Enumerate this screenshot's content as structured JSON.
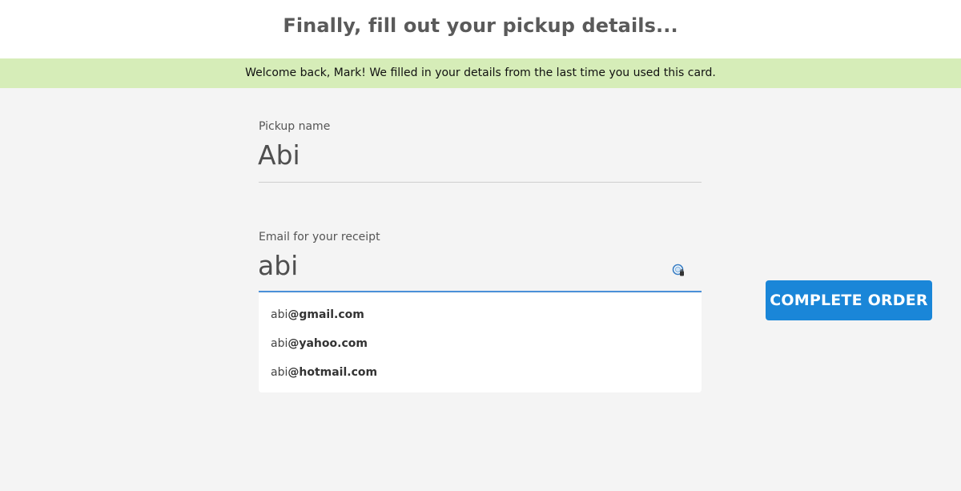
{
  "header": {
    "title": "Finally, fill out your pickup details..."
  },
  "banner": {
    "text": "Welcome back, Mark! We filled in your details from the last time you used this card."
  },
  "form": {
    "pickup_name": {
      "label": "Pickup name",
      "value": "Abi"
    },
    "email": {
      "label": "Email for your receipt",
      "value": "abi",
      "autofill_icon": "password-manager-key-icon"
    },
    "suggestions": [
      {
        "local": "abi",
        "domain": "@gmail.com"
      },
      {
        "local": "abi",
        "domain": "@yahoo.com"
      },
      {
        "local": "abi",
        "domain": "@hotmail.com"
      }
    ]
  },
  "actions": {
    "complete_label": "COMPLETE ORDER"
  },
  "colors": {
    "banner_bg": "#d6edb8",
    "button_bg": "#1a86d8",
    "focus_underline": "#4a90d9",
    "page_bg": "#f4f4f4"
  }
}
